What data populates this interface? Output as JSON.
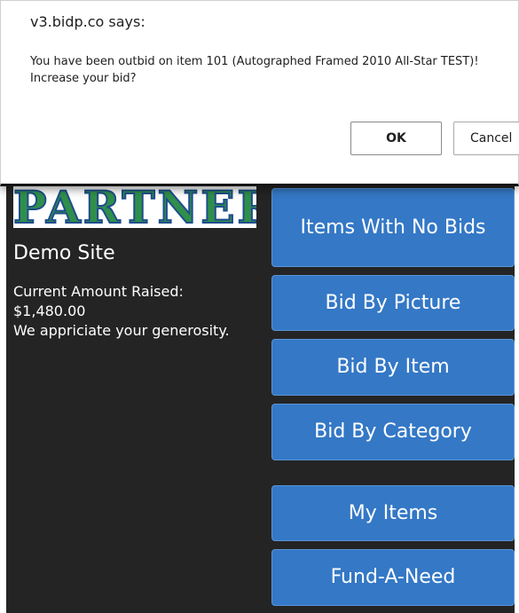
{
  "dialog": {
    "origin": "v3.bidp.co says:",
    "message": "You have been outbid on item 101 (Autographed Framed 2010 All-Star TEST)! Increase your bid?",
    "ok_label": "OK",
    "cancel_label": "Cancel"
  },
  "site": {
    "logo_text": "PARTNER",
    "name": "Demo Site",
    "raised_label": "Current Amount Raised:",
    "raised_amount": "$1,480.00",
    "thanks": "We appriciate your generosity."
  },
  "nav": {
    "items_no_bids": "Items With No Bids",
    "bid_by_picture": "Bid By Picture",
    "bid_by_item": "Bid By Item",
    "bid_by_category": "Bid By Category",
    "my_items": "My Items",
    "fund_a_need": "Fund-A-Need"
  },
  "colors": {
    "page_background": "#242424",
    "nav_button": "#3478c6",
    "logo_green": "#2f8f4a",
    "logo_outline": "#1e4d8c"
  }
}
